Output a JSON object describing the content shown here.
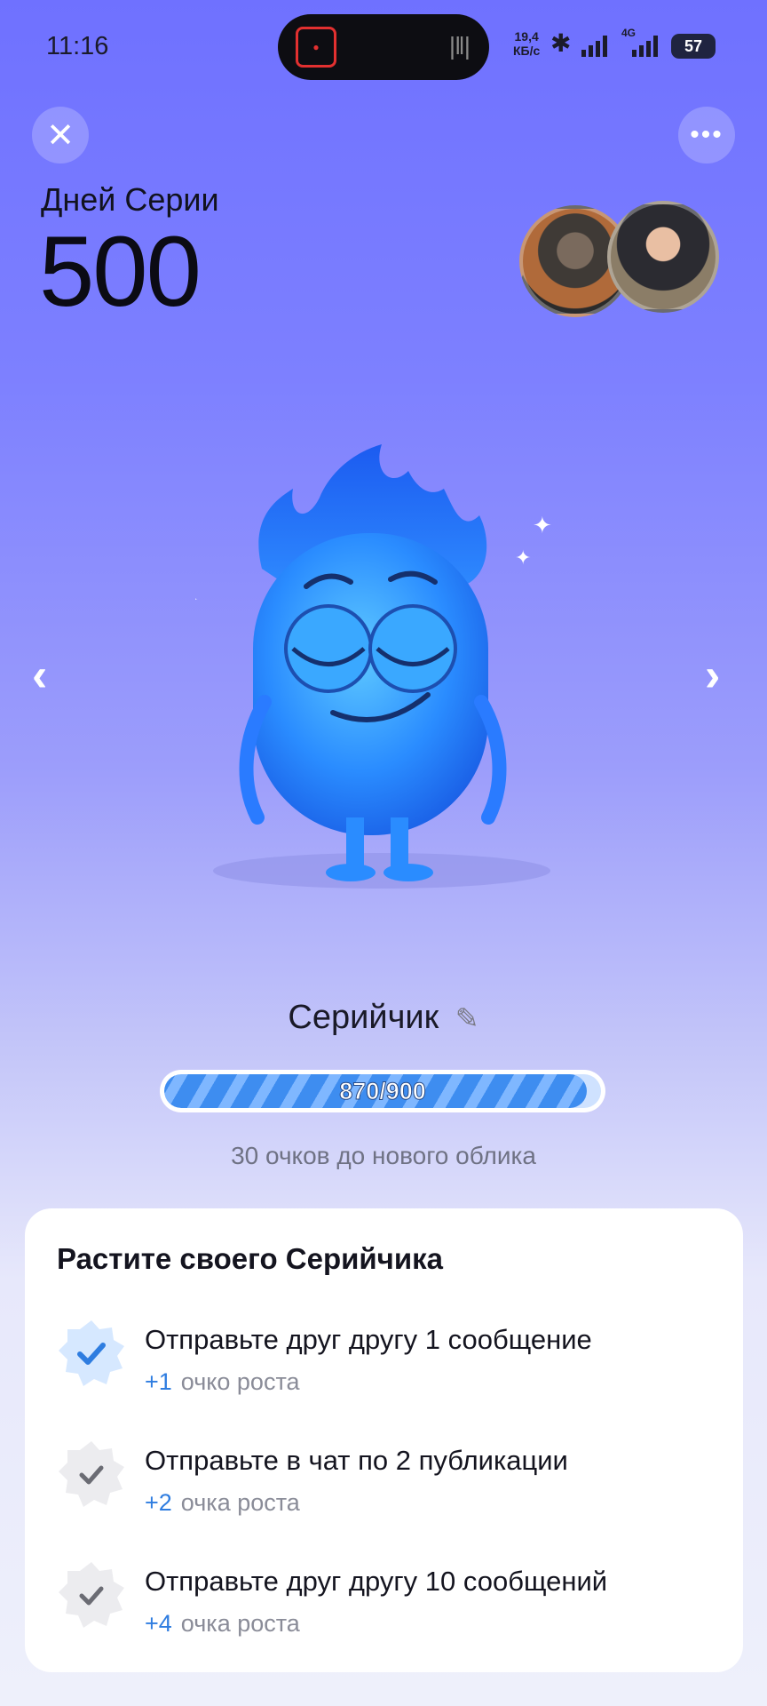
{
  "status_bar": {
    "time": "11:16",
    "speed_value": "19,4",
    "speed_unit": "КБ/с",
    "network": "4G",
    "battery": "57"
  },
  "header": {
    "streak_label": "Дней Серии",
    "streak_days": "500"
  },
  "pet": {
    "name": "Серийчик",
    "progress_text": "870/900",
    "progress_current": 870,
    "progress_max": 900,
    "progress_hint": "30 очков до нового облика"
  },
  "tasks_card": {
    "title": "Растите своего Серийчика",
    "tasks": [
      {
        "title": "Отправьте друг другу 1 сообщение",
        "points": "+1",
        "points_label": "очко роста",
        "completed": true
      },
      {
        "title": "Отправьте в чат по 2 публикации",
        "points": "+2",
        "points_label": "очка роста",
        "completed": false
      },
      {
        "title": "Отправьте друг другу 10 сообщений",
        "points": "+4",
        "points_label": "очка роста",
        "completed": false
      }
    ]
  },
  "icons": {
    "close": "close-icon",
    "more": "more-icon",
    "prev": "chevron-left-icon",
    "next": "chevron-right-icon",
    "edit": "pencil-icon",
    "check": "check-icon"
  },
  "colors": {
    "accent": "#2f7de0",
    "background_top": "#6f71ff",
    "mascot": "#2a8cff"
  }
}
